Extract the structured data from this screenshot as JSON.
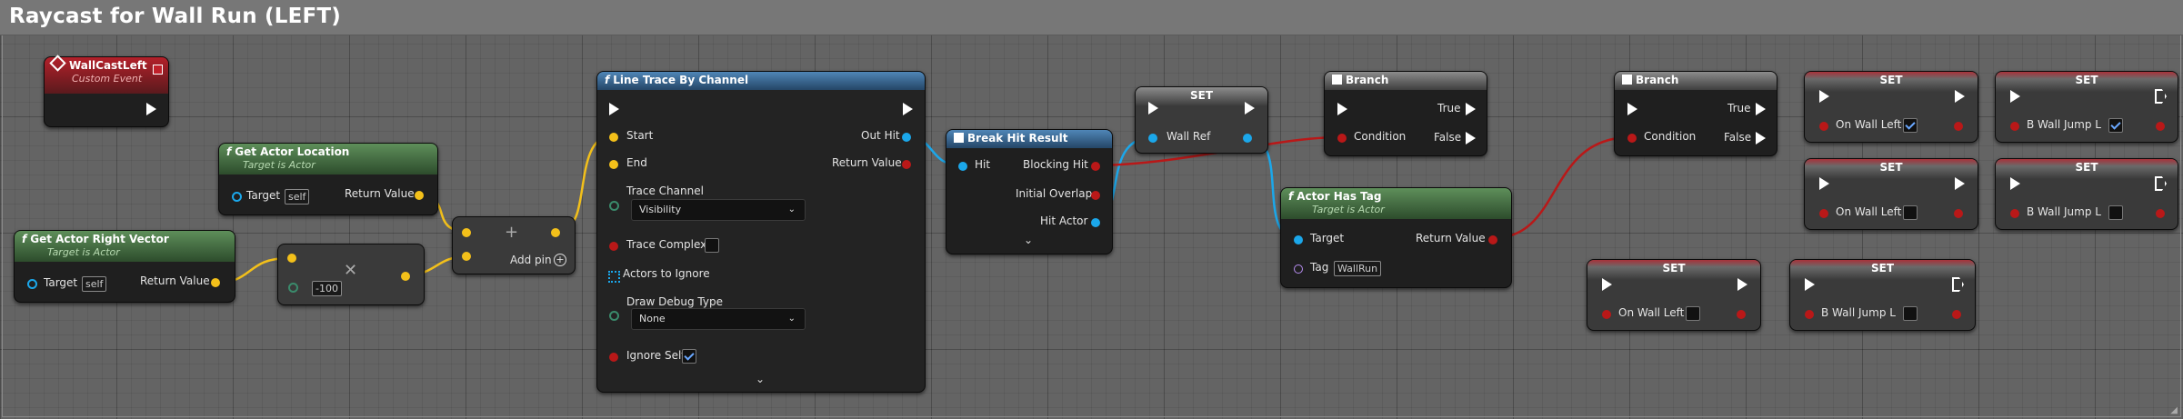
{
  "comment": {
    "title": "Raycast for Wall Run (LEFT)"
  },
  "colors": {
    "event_header": "#b3202a",
    "pure_header": "#5e8f5a",
    "function_header": "#4f86b7",
    "exec_wire": "#ffffff",
    "vector_wire": "#f3c01a",
    "bool_wire": "#b91818",
    "object_wire": "#1ba7ea"
  },
  "nodes": {
    "wallcast_event": {
      "title": "WallCastLeft",
      "subtitle": "Custom Event"
    },
    "get_actor_location": {
      "title": "Get Actor Location",
      "subtitle": "Target is Actor",
      "target_label": "Target",
      "target_value": "self",
      "return_label": "Return Value"
    },
    "get_actor_right_vector": {
      "title": "Get Actor Right Vector",
      "subtitle": "Target is Actor",
      "target_label": "Target",
      "target_value": "self",
      "return_label": "Return Value"
    },
    "multiply": {
      "value": "-100",
      "op_icon": "multiply-icon"
    },
    "add": {
      "add_pin_label": "Add pin",
      "plus_icon": "plus-icon"
    },
    "line_trace": {
      "title": "Line Trace By Channel",
      "start_label": "Start",
      "end_label": "End",
      "out_hit_label": "Out Hit",
      "return_label": "Return Value",
      "trace_channel_label": "Trace Channel",
      "trace_channel_value": "Visibility",
      "trace_complex_label": "Trace Complex",
      "actors_ignore_label": "Actors to Ignore",
      "draw_debug_label": "Draw Debug Type",
      "draw_debug_value": "None",
      "ignore_self_label": "Ignore Self"
    },
    "break_hit": {
      "title": "Break Hit Result",
      "hit_label": "Hit",
      "blocking_label": "Blocking Hit",
      "overlap_label": "Initial Overlap",
      "hit_actor_label": "Hit Actor"
    },
    "set_wall_ref": {
      "title": "SET",
      "var_label": "Wall Ref"
    },
    "branch1": {
      "title": "Branch",
      "true_label": "True",
      "false_label": "False",
      "condition_label": "Condition"
    },
    "actor_has_tag": {
      "title": "Actor Has Tag",
      "subtitle": "Target is Actor",
      "target_label": "Target",
      "tag_label": "Tag",
      "tag_value": "WallRun",
      "return_label": "Return Value"
    },
    "branch2": {
      "title": "Branch",
      "true_label": "True",
      "false_label": "False",
      "condition_label": "Condition"
    },
    "set_nodes": [
      {
        "title": "SET",
        "var_label": "On Wall Left",
        "checked": true
      },
      {
        "title": "SET",
        "var_label": "B Wall Jump L",
        "checked": true
      },
      {
        "title": "SET",
        "var_label": "On Wall Left",
        "checked": false
      },
      {
        "title": "SET",
        "var_label": "B Wall Jump L",
        "checked": false
      },
      {
        "title": "SET",
        "var_label": "On Wall Left",
        "checked": false
      },
      {
        "title": "SET",
        "var_label": "B Wall Jump L",
        "checked": false
      }
    ]
  }
}
